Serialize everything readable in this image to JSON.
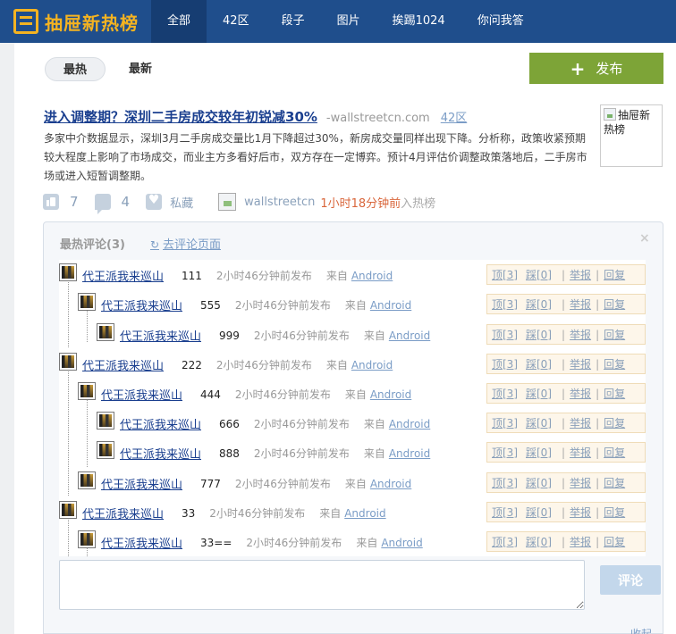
{
  "header": {
    "logo_text": "抽屉新热榜",
    "nav": [
      "全部",
      "42区",
      "段子",
      "图片",
      "挨踢1024",
      "你问我答"
    ]
  },
  "subtabs": [
    "最热",
    "最新"
  ],
  "publish": {
    "plus": "+",
    "label": "发布"
  },
  "article": {
    "title": "进入调整期？深圳二手房成交较年初锐减30%",
    "source": "-wallstreetcn.com",
    "zone": "42区",
    "body": "多家中介数据显示，深圳3月二手房成交量比1月下降超过30%，新房成交量同样出现下降。分析称，政策收紧预期较大程度上影响了市场成交，而业主方多看好后市，双方存在一定博弈。预计4月评估价调整政策落地后，二手房市场或进入短暂调整期。",
    "thumb_alt": "抽屉新热榜",
    "likes": "7",
    "comments": "4",
    "favorite": "私藏",
    "poster": "wallstreetcn",
    "posted_time": "1小时18分钟前",
    "posted_suffix": "入热榜"
  },
  "comments_box": {
    "title": "最热评论(3)",
    "link_icon": "↻",
    "link": "去评论页面",
    "close": "×",
    "items": [
      {
        "user": "代王派我来巡山",
        "text": "111",
        "time": "2小时46分钟前发布",
        "from": "来自",
        "device": "Android"
      },
      {
        "user": "代王派我来巡山",
        "text": "555",
        "time": "2小时46分钟前发布",
        "from": "来自",
        "device": "Android"
      },
      {
        "user": "代王派我来巡山",
        "text": "999",
        "time": "2小时46分钟前发布",
        "from": "来自",
        "device": "Android"
      },
      {
        "user": "代王派我来巡山",
        "text": "222",
        "time": "2小时46分钟前发布",
        "from": "来自",
        "device": "Android"
      },
      {
        "user": "代王派我来巡山",
        "text": "444",
        "time": "2小时46分钟前发布",
        "from": "来自",
        "device": "Android"
      },
      {
        "user": "代王派我来巡山",
        "text": "666",
        "time": "2小时46分钟前发布",
        "from": "来自",
        "device": "Android"
      },
      {
        "user": "代王派我来巡山",
        "text": "888",
        "time": "2小时46分钟前发布",
        "from": "来自",
        "device": "Android"
      },
      {
        "user": "代王派我来巡山",
        "text": "777",
        "time": "2小时46分钟前发布",
        "from": "来自",
        "device": "Android"
      },
      {
        "user": "代王派我来巡山",
        "text": "33",
        "time": "2小时46分钟前发布",
        "from": "来自",
        "device": "Android"
      },
      {
        "user": "代王派我来巡山",
        "text": "33==",
        "time": "2小时46分钟前发布",
        "from": "来自",
        "device": "Android"
      }
    ],
    "actions": {
      "ding": "顶[3]",
      "cai": "踩[0]",
      "sep": "|",
      "report": "举报",
      "reply": "回复"
    },
    "submit": "评论",
    "collapse": "收起"
  }
}
